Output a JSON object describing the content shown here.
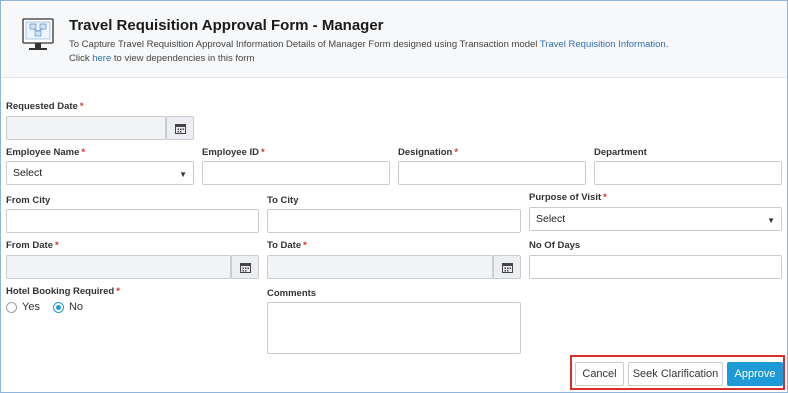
{
  "header": {
    "title": "Travel Requisition Approval Form - Manager",
    "desc_prefix": "To Capture Travel Requisition Approval Information Details of Manager Form designed using Transaction model",
    "desc_link": "Travel Requisition Information",
    "desc_suffix": ".",
    "click_prefix": "Click",
    "click_link": "here",
    "click_suffix": "to view dependencies in this form"
  },
  "form": {
    "requested_date_label": "Requested Date",
    "employee_name_label": "Employee Name",
    "employee_name_value": "Select",
    "employee_id_label": "Employee ID",
    "designation_label": "Designation",
    "department_label": "Department",
    "from_city_label": "From City",
    "to_city_label": "To City",
    "purpose_label": "Purpose of Visit",
    "purpose_value": "Select",
    "from_date_label": "From Date",
    "to_date_label": "To Date",
    "no_of_days_label": "No Of Days",
    "hotel_label": "Hotel Booking Required",
    "hotel_options": {
      "yes": "Yes",
      "no": "No"
    },
    "hotel_selected": "No",
    "comments_label": "Comments",
    "required_mark": "*"
  },
  "actions": {
    "cancel": "Cancel",
    "seek": "Seek Clarification",
    "approve": "Approve"
  },
  "icons": {
    "calendar": "calendar-icon",
    "caret": "caret-down-icon",
    "form": "form-monitor-icon"
  },
  "colors": {
    "accent": "#1e9bd7",
    "required": "#d9302c",
    "link": "#2f6fb3",
    "highlight_border": "#d9302c"
  }
}
